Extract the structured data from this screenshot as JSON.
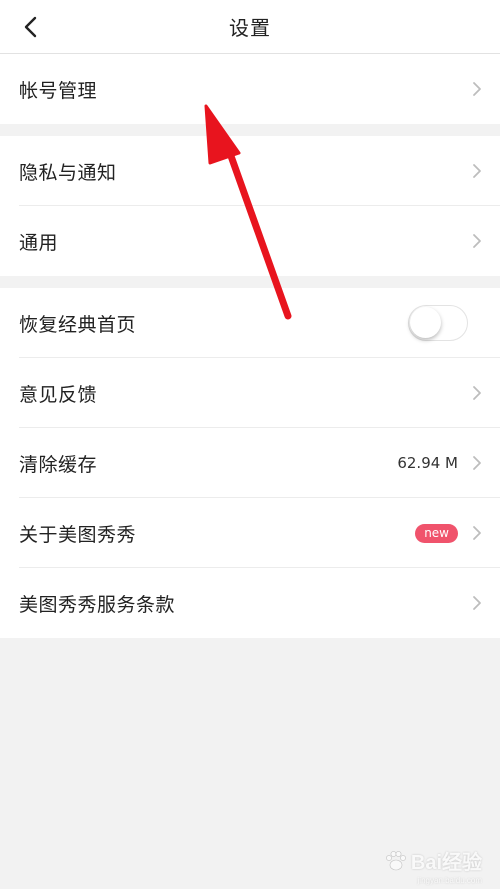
{
  "header": {
    "title": "设置",
    "back_icon": "chevron-left-icon"
  },
  "groups": [
    {
      "rows": [
        {
          "label": "帐号管理",
          "trailing": "chevron-right-icon"
        }
      ]
    },
    {
      "rows": [
        {
          "label": "隐私与通知",
          "trailing": "chevron-right-icon"
        },
        {
          "label": "通用",
          "trailing": "chevron-right-icon"
        }
      ]
    },
    {
      "rows": [
        {
          "label": "恢复经典首页",
          "trailing": "toggle",
          "toggle_on": false
        },
        {
          "label": "意见反馈",
          "trailing": "chevron-right-icon"
        },
        {
          "label": "清除缓存",
          "value": "62.94 M",
          "trailing": "chevron-right-icon"
        },
        {
          "label": "关于美图秀秀",
          "badge": "new",
          "trailing": "chevron-right-icon"
        },
        {
          "label": "美图秀秀服务条款",
          "trailing": "chevron-right-icon"
        }
      ]
    }
  ],
  "annotation": {
    "color": "#e8141e",
    "icon": "red-arrow-annotation"
  },
  "watermark": {
    "text": "Bai经验",
    "sub": "jingyan.baidu.com"
  },
  "colors": {
    "badge": "#f0536c",
    "background": "#f2f2f2",
    "chevron": "#bdbdbd"
  }
}
